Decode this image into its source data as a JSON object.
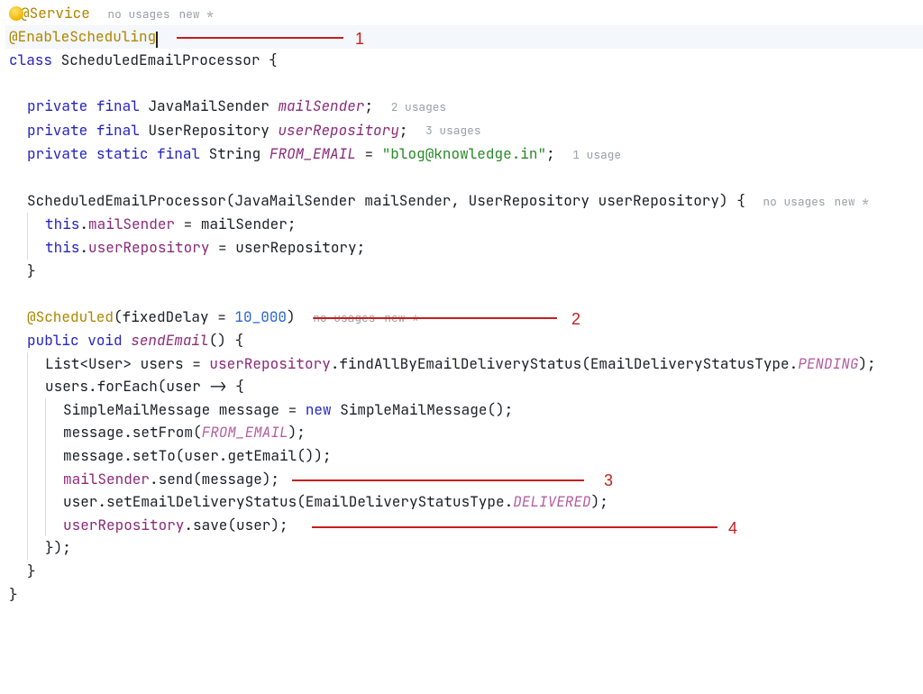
{
  "hints": {
    "noUsages": "no usages",
    "newStar": "new *",
    "u2": "2 usages",
    "u3": "3 usages",
    "u1": "1 usage"
  },
  "annotations": {
    "service": "@Service",
    "enableScheduling": "@EnableScheduling",
    "scheduled": "@Scheduled"
  },
  "arrowLabels": {
    "a1": "1",
    "a2": "2",
    "a3": "3",
    "a4": "4"
  },
  "t": {
    "class": "class",
    "className": "ScheduledEmailProcessor",
    "obr": " {",
    "cbr": "}",
    "semi": ";",
    "priv": "private",
    "final": "final",
    "static": "static",
    "String": "String",
    "void": "void",
    "public": "public",
    "new": "new",
    "JavaMailSender": "JavaMailSender",
    "UserRepository": "UserRepository",
    "mailSender": "mailSender",
    "userRepository": "userRepository",
    "FROM_EMAIL": "FROM_EMAIL",
    "fromEmailVal": "\"blog@knowledge.in\"",
    "ctorSig": "ScheduledEmailProcessor(JavaMailSender mailSender, UserRepository userRepository) {",
    "thisMail": "this",
    "dot": ".",
    "eq": " = ",
    "eqAssign": " = ",
    "mailSenderAssign": "mailSender = mailSender;",
    "userRepoAssign": "userRepository = userRepository;",
    "fixedDelay": "(fixedDelay = ",
    "tenK": "10_000",
    "sendEmail": "sendEmail",
    "line_list_a": "List<User> users = ",
    "line_list_b": ".findAllByEmailDeliveryStatus(EmailDeliveryStatusType.",
    "PENDING": "PENDING",
    "closeParenSemi": ");",
    "forEach": "users.forEach(user -> {",
    "SimpleMailMessage": "SimpleMailMessage",
    "msgVar": " message = ",
    "simpleCtor": " SimpleMailMessage();",
    "setFrom_a": "message.setFrom(",
    "setFrom_b": ");",
    "setTo": "message.setTo(user.getEmail());",
    "send_a": ".send(message);",
    "setStatus_a": "user.setEmailDeliveryStatus(EmailDeliveryStatusType.",
    "DELIVERED": "DELIVERED",
    "save_a": ".save(user);",
    "closeLambda": "});"
  }
}
